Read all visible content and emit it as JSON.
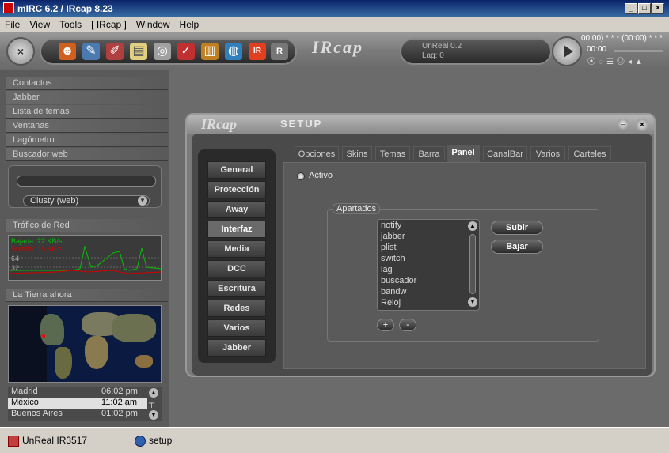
{
  "window": {
    "title": "mIRC 6.2 / IRcap 8.23"
  },
  "menu": [
    "File",
    "View",
    "Tools",
    "[ IRcap ]",
    "Window",
    "Help"
  ],
  "toolbar": {
    "server": "UnReal 0.2",
    "lag": "Lag: 0",
    "time1": "00:00) * * * (00:00) * * *",
    "time2": "00:00"
  },
  "sidebar": {
    "sections": [
      "Contactos",
      "Jabber",
      "Lista de temas",
      "Ventanas",
      "Lagómetro",
      "Buscador web"
    ],
    "search_engine": "Clusty (web)",
    "traffic_title": "Tráfico de Red",
    "traffic_down": "Bajada: 22 KB/s",
    "traffic_up": "Subida: 15 KB/s",
    "traffic_64": "64",
    "traffic_32": "32",
    "earth_title": "La Tierra ahora",
    "clocks": [
      {
        "city": "Madrid",
        "time": "06:02 pm"
      },
      {
        "city": "México",
        "time": "11:02 am"
      },
      {
        "city": "Buenos Aires",
        "time": "01:02 pm"
      }
    ]
  },
  "setup": {
    "title": "SETUP",
    "nav": [
      "General",
      "Protección",
      "Away",
      "Interfaz",
      "Media",
      "DCC",
      "Escritura",
      "Redes",
      "Varios",
      "Jabber"
    ],
    "active_nav": "Interfaz",
    "tabs": [
      "Opciones",
      "Skins",
      "Temas",
      "Barra",
      "Panel",
      "CanalBar",
      "Varios",
      "Carteles"
    ],
    "active_tab": "Panel",
    "activo_label": "Activo",
    "group_label": "Apartados",
    "list": [
      "notify",
      "jabber",
      "plist",
      "switch",
      "lag",
      "buscador",
      "bandw",
      "Reloj"
    ],
    "btn_up": "Subir",
    "btn_down": "Bajar",
    "btn_add": "+",
    "btn_remove": "-"
  },
  "taskbar": [
    {
      "label": "UnReal IR3517"
    },
    {
      "label": "setup"
    }
  ],
  "colors": {
    "traffic_down": "#00c000",
    "traffic_up": "#d00000",
    "accent": "#0a246a"
  }
}
